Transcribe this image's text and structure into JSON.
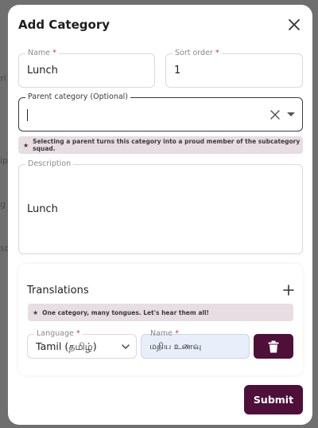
{
  "backdrop": {
    "hints": [
      "ri",
      "ip",
      "g",
      "sc"
    ]
  },
  "dialog": {
    "title": "Add Category",
    "name_field": {
      "label": "Name",
      "required_mark": "*",
      "value": "Lunch"
    },
    "sort_field": {
      "label": "Sort order",
      "required_mark": "*",
      "value": "1"
    },
    "parent_field": {
      "label": "Parent category (Optional)",
      "value": ""
    },
    "parent_hint": {
      "icon": "star-icon",
      "text": "Selecting a parent turns this category into a proud member of the subcategory squad."
    },
    "description_field": {
      "label": "Description",
      "value": "Lunch"
    },
    "translations": {
      "title": "Translations",
      "hint": {
        "icon": "star-icon",
        "text": "One category, many tongues. Let's hear them all!"
      },
      "row": {
        "language_label": "Language",
        "language_required_mark": "*",
        "language_value": "Tamil (தமிழ்)",
        "name_label": "Name",
        "name_required_mark": "*",
        "name_value": "மதிய உணவு"
      }
    },
    "submit_label": "Submit"
  },
  "colors": {
    "accent": "#4e0f38",
    "hint_bg": "#e7dde3",
    "input_highlight": "#e8eefa",
    "required": "#c23b3b"
  },
  "icons": {
    "close": "close-icon",
    "clear": "clear-icon",
    "dropdown": "caret-down-icon",
    "add": "plus-icon",
    "delete": "trash-icon",
    "chevron": "chevron-down-icon"
  }
}
